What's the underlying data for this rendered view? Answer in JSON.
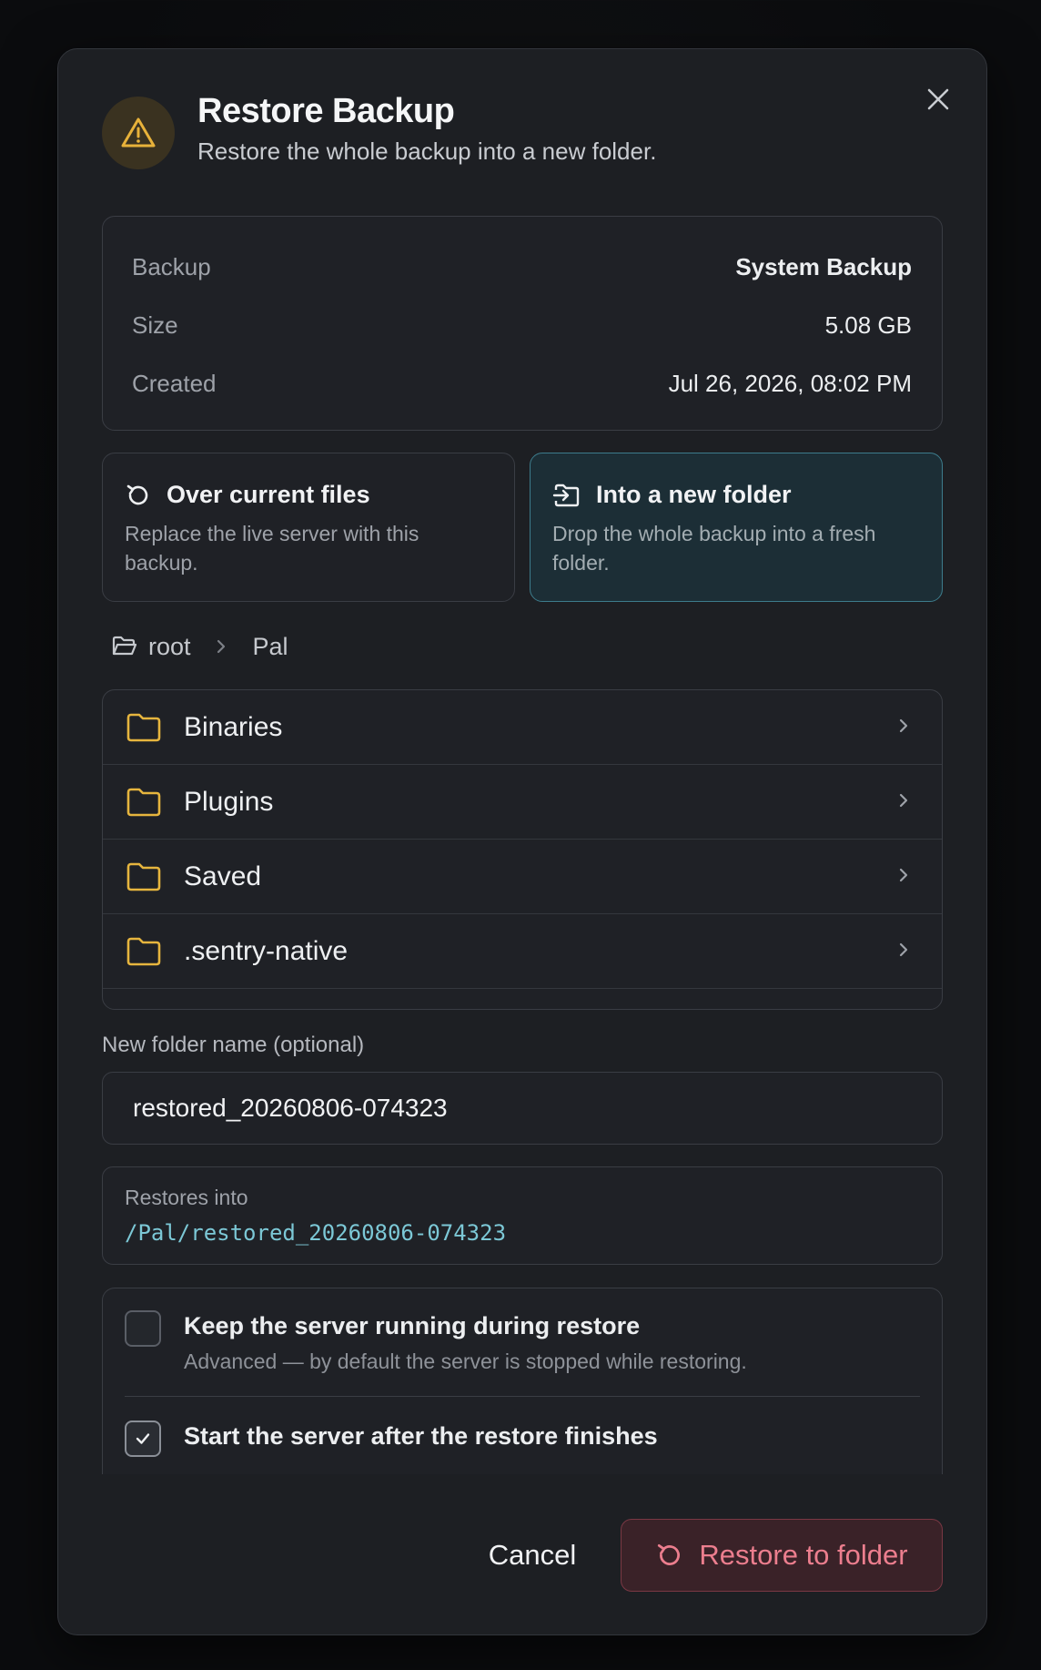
{
  "dialog": {
    "title": "Restore Backup",
    "subtitle": "Restore the whole backup into a new folder."
  },
  "info": {
    "backup_label": "Backup",
    "backup_value": "System Backup",
    "size_label": "Size",
    "size_value": "5.08 GB",
    "created_label": "Created",
    "created_value": "Jul 26, 2026, 08:02 PM"
  },
  "modes": [
    {
      "title": "Over current files",
      "desc": "Replace the live server with this backup.",
      "icon": "restore-icon",
      "selected": false
    },
    {
      "title": "Into a new folder",
      "desc": "Drop the whole backup into a fresh folder.",
      "icon": "folder-import-icon",
      "selected": true
    }
  ],
  "breadcrumb": {
    "root": "root",
    "current": "Pal"
  },
  "folders": [
    {
      "name": "Binaries"
    },
    {
      "name": "Plugins"
    },
    {
      "name": "Saved"
    },
    {
      "name": ".sentry-native"
    }
  ],
  "new_folder": {
    "label": "New folder name (optional)",
    "value": "restored_20260806-074323"
  },
  "restores_into": {
    "label": "Restores into",
    "path": "/Pal/restored_20260806-074323"
  },
  "options": {
    "keep_running_title": "Keep the server running during restore",
    "keep_running_sub": "Advanced — by default the server is stopped while restoring.",
    "keep_running_checked": false,
    "start_after_title": "Start the server after the restore finishes",
    "start_after_checked": true
  },
  "footer": {
    "cancel_label": "Cancel",
    "restore_label": "Restore to folder"
  },
  "colors": {
    "accent_teal": "#3d7c8c",
    "warning": "#e8b23a",
    "danger": "#ec7e8e",
    "folder": "#e6b53e"
  }
}
